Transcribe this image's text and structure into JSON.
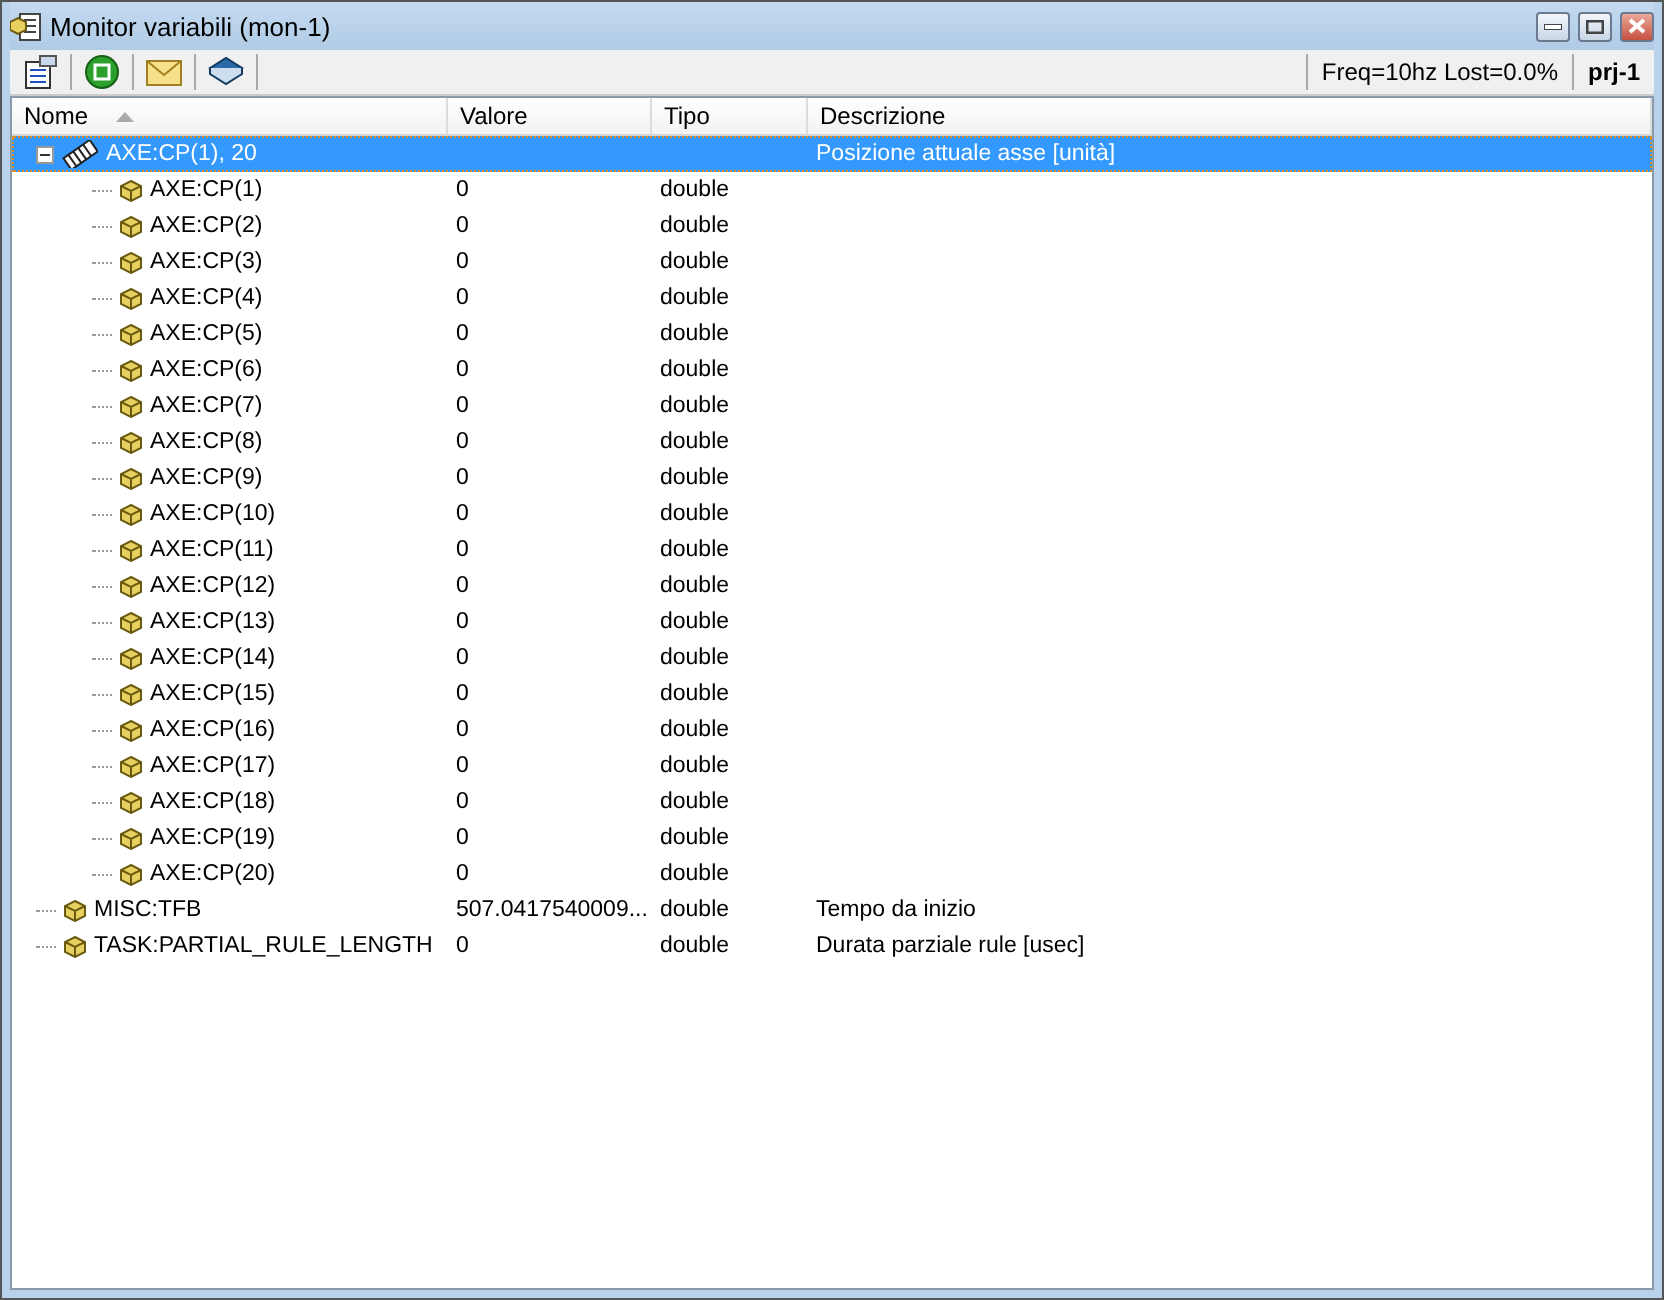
{
  "window": {
    "title": "Monitor variabili (mon-1)"
  },
  "toolbar": {
    "status": "Freq=10hz Lost=0.0%",
    "project": "prj-1"
  },
  "columns": [
    {
      "label": "Nome",
      "sorted": true
    },
    {
      "label": "Valore",
      "sorted": false
    },
    {
      "label": "Tipo",
      "sorted": false
    },
    {
      "label": "Descrizione",
      "sorted": false
    }
  ],
  "tree": [
    {
      "kind": "group",
      "name": "AXE:CP(1), 20",
      "description": "Posizione attuale asse [unità]",
      "selected": true,
      "expanded": true,
      "children": [
        {
          "kind": "variable",
          "name": "AXE:CP(1)",
          "value": "0",
          "type": "double",
          "selected": false
        },
        {
          "kind": "variable",
          "name": "AXE:CP(2)",
          "value": "0",
          "type": "double",
          "selected": false
        },
        {
          "kind": "variable",
          "name": "AXE:CP(3)",
          "value": "0",
          "type": "double",
          "selected": false
        },
        {
          "kind": "variable",
          "name": "AXE:CP(4)",
          "value": "0",
          "type": "double",
          "selected": false
        },
        {
          "kind": "variable",
          "name": "AXE:CP(5)",
          "value": "0",
          "type": "double",
          "selected": false
        },
        {
          "kind": "variable",
          "name": "AXE:CP(6)",
          "value": "0",
          "type": "double",
          "selected": false
        },
        {
          "kind": "variable",
          "name": "AXE:CP(7)",
          "value": "0",
          "type": "double",
          "selected": false
        },
        {
          "kind": "variable",
          "name": "AXE:CP(8)",
          "value": "0",
          "type": "double",
          "selected": false
        },
        {
          "kind": "variable",
          "name": "AXE:CP(9)",
          "value": "0",
          "type": "double",
          "selected": false
        },
        {
          "kind": "variable",
          "name": "AXE:CP(10)",
          "value": "0",
          "type": "double",
          "selected": false
        },
        {
          "kind": "variable",
          "name": "AXE:CP(11)",
          "value": "0",
          "type": "double",
          "selected": false
        },
        {
          "kind": "variable",
          "name": "AXE:CP(12)",
          "value": "0",
          "type": "double",
          "selected": false
        },
        {
          "kind": "variable",
          "name": "AXE:CP(13)",
          "value": "0",
          "type": "double",
          "selected": false
        },
        {
          "kind": "variable",
          "name": "AXE:CP(14)",
          "value": "0",
          "type": "double",
          "selected": false
        },
        {
          "kind": "variable",
          "name": "AXE:CP(15)",
          "value": "0",
          "type": "double",
          "selected": false
        },
        {
          "kind": "variable",
          "name": "AXE:CP(16)",
          "value": "0",
          "type": "double",
          "selected": false
        },
        {
          "kind": "variable",
          "name": "AXE:CP(17)",
          "value": "0",
          "type": "double",
          "selected": false
        },
        {
          "kind": "variable",
          "name": "AXE:CP(18)",
          "value": "0",
          "type": "double",
          "selected": false
        },
        {
          "kind": "variable",
          "name": "AXE:CP(19)",
          "value": "0",
          "type": "double",
          "selected": false
        },
        {
          "kind": "variable",
          "name": "AXE:CP(20)",
          "value": "0",
          "type": "double",
          "selected": false
        }
      ]
    },
    {
      "kind": "variable",
      "name": "MISC:TFB",
      "value": "507.0417540009...",
      "type": "double",
      "description": "Tempo da inizio",
      "selected": false
    },
    {
      "kind": "variable",
      "name": "TASK:PARTIAL_RULE_LENGTH",
      "value": "0",
      "type": "double",
      "description": "Durata parziale rule [usec]",
      "selected": false
    }
  ]
}
